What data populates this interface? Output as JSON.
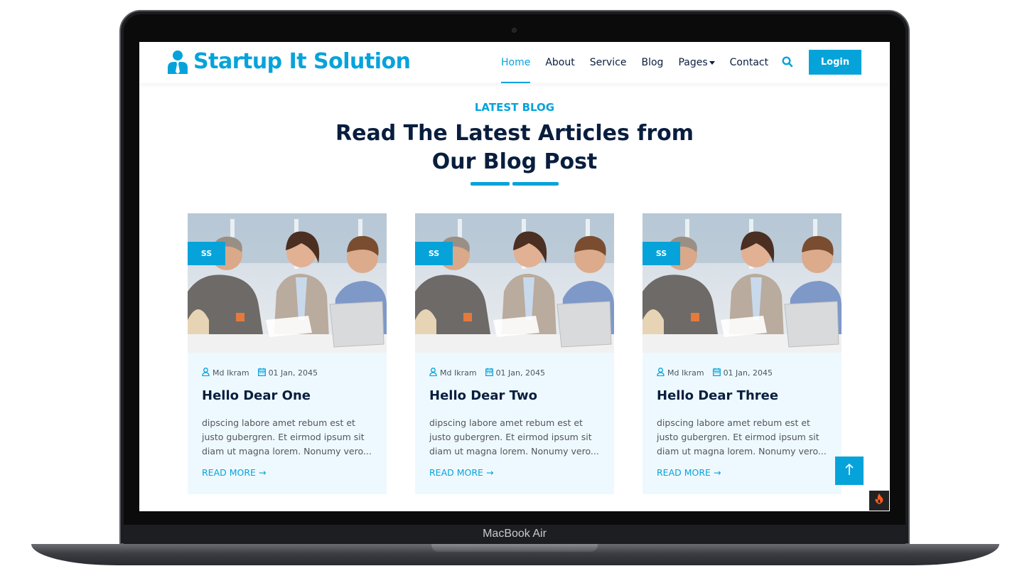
{
  "device": {
    "model_label": "MacBook Air"
  },
  "brand": {
    "name": "Startup It Solution"
  },
  "nav": {
    "items": [
      {
        "label": "Home"
      },
      {
        "label": "About"
      },
      {
        "label": "Service"
      },
      {
        "label": "Blog"
      },
      {
        "label": "Pages"
      },
      {
        "label": "Contact"
      }
    ],
    "login_label": "Login"
  },
  "section": {
    "subtitle": "LATEST BLOG",
    "title_line1": "Read The Latest Articles from",
    "title_line2": "Our Blog Post"
  },
  "posts": [
    {
      "badge": "SS",
      "author": "Md Ikram",
      "date": "01 Jan, 2045",
      "title": "Hello Dear One",
      "excerpt": "dipscing labore amet rebum est et justo gubergren. Et eirmod ipsum sit diam ut magna lorem. Nonumy vero...",
      "read_more": "READ MORE"
    },
    {
      "badge": "SS",
      "author": "Md Ikram",
      "date": "01 Jan, 2045",
      "title": "Hello Dear Two",
      "excerpt": "dipscing labore amet rebum est et justo gubergren. Et eirmod ipsum sit diam ut magna lorem. Nonumy vero...",
      "read_more": "READ MORE"
    },
    {
      "badge": "SS",
      "author": "Md Ikram",
      "date": "01 Jan, 2045",
      "title": "Hello Dear Three",
      "excerpt": "dipscing labore amet rebum est et justo gubergren. Et eirmod ipsum sit diam ut magna lorem. Nonumy vero...",
      "read_more": "READ MORE"
    }
  ],
  "colors": {
    "primary": "#06A3DA",
    "dark": "#091E3E",
    "card_bg": "#EEF9FF"
  },
  "icons": [
    "user-tie-icon",
    "search-icon",
    "user-icon",
    "calendar-icon",
    "arrow-right-icon",
    "arrow-up-icon",
    "fire-icon"
  ]
}
